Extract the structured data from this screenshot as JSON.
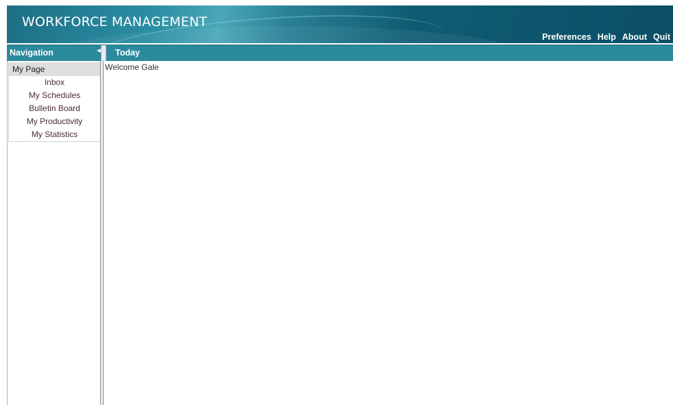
{
  "app": {
    "title": "WORKFORCE MANAGEMENT"
  },
  "top_links": [
    "Preferences",
    "Help",
    "About",
    "Quit"
  ],
  "headers": {
    "navigation": "Navigation",
    "today": "Today"
  },
  "sidebar": {
    "group_title": "My Page",
    "items": [
      "Inbox",
      "My Schedules",
      "Bulletin Board",
      "My Productivity",
      "My Statistics"
    ]
  },
  "main": {
    "welcome": "Welcome Gale"
  },
  "colors": {
    "banner": "#0f5d73",
    "header_bar": "#2b8a9c",
    "nav_item_text": "#4a2a3c"
  },
  "icons": {
    "collapse": "collapse-left-icon"
  }
}
